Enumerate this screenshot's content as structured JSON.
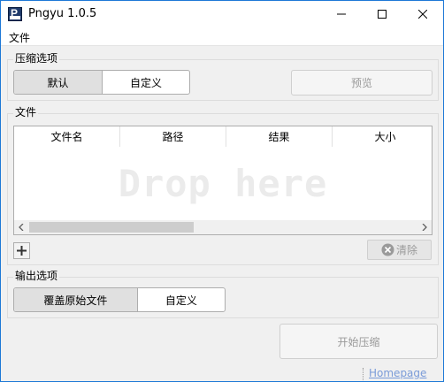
{
  "window": {
    "title": "Pngyu 1.0.5"
  },
  "menu": {
    "file": "文件"
  },
  "compression": {
    "group_title": "压缩选项",
    "default_label": "默认",
    "custom_label": "自定义",
    "preview_label": "预览"
  },
  "files": {
    "group_title": "文件",
    "columns": [
      "文件名",
      "路径",
      "结果",
      "大小"
    ],
    "drop_text": "Drop here",
    "clear_label": "清除"
  },
  "output": {
    "group_title": "输出选项",
    "overwrite_label": "覆盖原始文件",
    "custom_label": "自定义"
  },
  "actions": {
    "start_label": "开始压缩"
  },
  "footer": {
    "homepage_label": "Homepage"
  },
  "icons": {
    "app": "pngyu-app-icon",
    "minimize": "minimize-icon",
    "maximize": "maximize-icon",
    "close": "close-icon",
    "add": "plus-icon",
    "clear": "clear-circle-x-icon",
    "scroll_left": "chevron-left-icon",
    "scroll_right": "chevron-right-icon"
  },
  "colors": {
    "window_border": "#1d78d6",
    "link": "#7a9bd8"
  }
}
